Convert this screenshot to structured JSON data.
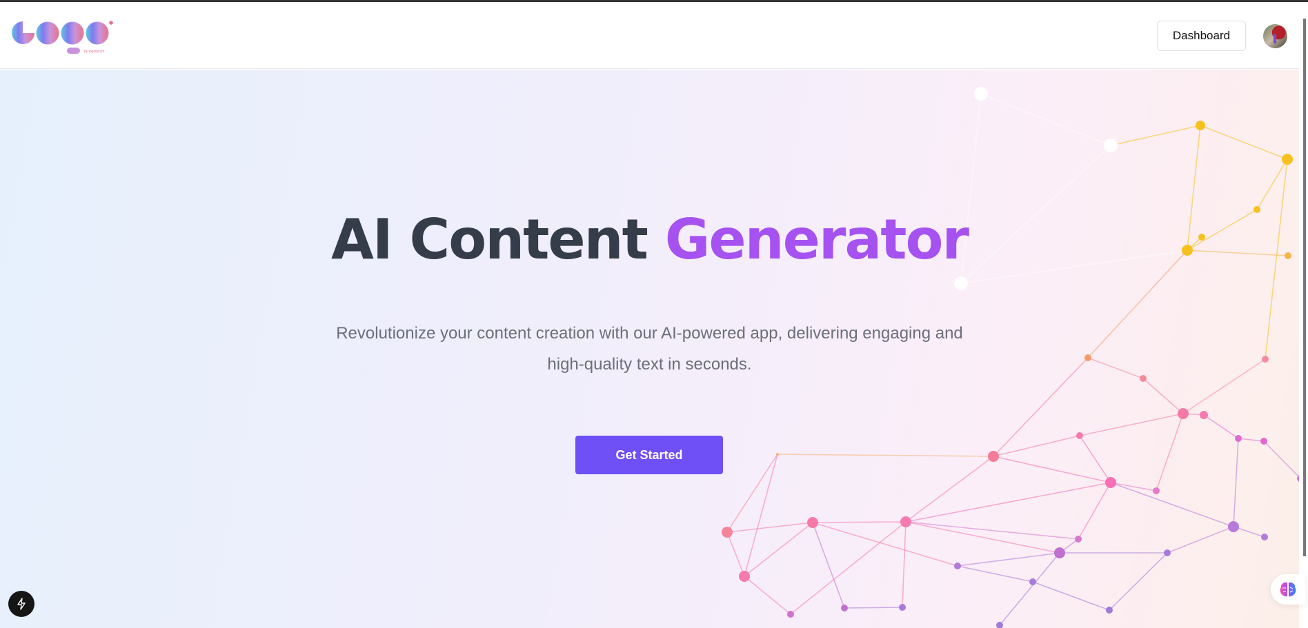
{
  "header": {
    "logo_text": "logo",
    "logo_tagline": "by logoipsum",
    "dashboard_label": "Dashboard"
  },
  "hero": {
    "title_main": "AI Content",
    "title_accent": "Generator",
    "subtitle": "Revolutionize your content creation with our AI-powered app, delivering engaging and high-quality text in seconds.",
    "cta_label": "Get Started"
  },
  "colors": {
    "accent": "#a552f0",
    "button": "#6f4ff6",
    "title": "#353c4a"
  }
}
